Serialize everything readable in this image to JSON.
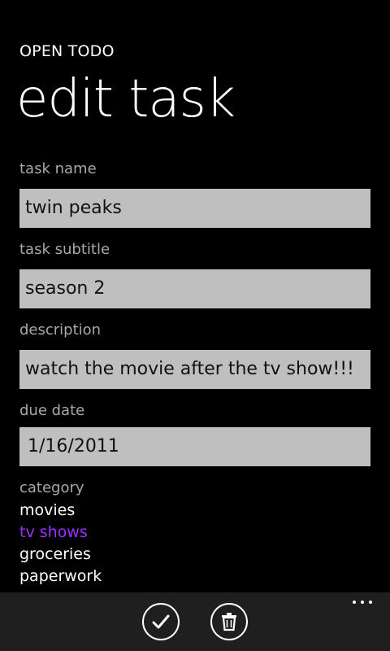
{
  "header": {
    "app_title": "OPEN TODO",
    "page_title": "edit task"
  },
  "form": {
    "task_name": {
      "label": "task name",
      "value": "twin peaks"
    },
    "task_subtitle": {
      "label": "task subtitle",
      "value": "season 2"
    },
    "description": {
      "label": "description",
      "value": "watch the movie after the tv show!!!"
    },
    "due_date": {
      "label": "due date",
      "value": "1/16/2011"
    },
    "category": {
      "label": "category",
      "items": [
        "movies",
        "tv shows",
        "groceries",
        "paperwork"
      ],
      "selected": "tv shows"
    }
  },
  "appbar": {
    "buttons": [
      {
        "icon": "check-icon"
      },
      {
        "icon": "trash-icon"
      }
    ],
    "more_icon": "ellipsis-icon"
  },
  "colors": {
    "background": "#000000",
    "textbox": "#bfbfbf",
    "accent": "#9b30ff",
    "appbar": "#1f1f1f"
  }
}
